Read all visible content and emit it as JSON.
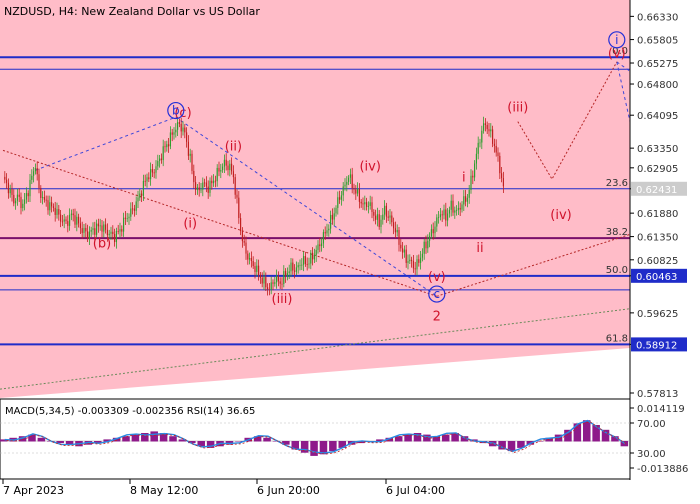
{
  "header": {
    "title": "NZDUSD, H4:  New Zealand Dollar vs US Dollar"
  },
  "colors": {
    "pink": "#ffbcc8",
    "candle_up": "#2e9e2e",
    "candle_down": "#c11f1f",
    "fib_blue": "#1f2cc9",
    "fib_purple": "#7a0f6a",
    "wave_label": "#d0122b",
    "wave_circle": "#2430d8",
    "trend_blue": "#3e47d9",
    "trend_red": "#b52626",
    "trend_green": "#6a8a5a",
    "macd_hist": "#8e1a8a",
    "rsi_line": "#2a8ae0",
    "price_red": "#e2202a",
    "price_gray": "#cccccc"
  },
  "chart_data": [
    {
      "type": "candlestick",
      "symbol": "NZDUSD",
      "timeframe": "H4",
      "ylim": [
        0.577,
        0.667
      ],
      "y_ticks": [
        "0.66330",
        "0.65805",
        "0.65275",
        "0.64800",
        "0.64095",
        "0.63350",
        "0.62905",
        "0.62431",
        "0.61880",
        "0.61350",
        "0.60825",
        "0.60463",
        "0.59625",
        "0.58912",
        "0.57813"
      ],
      "x_ticks": [
        "7 Apr 2023",
        "8 May 12:00",
        "6 Jun 20:00",
        "6 Jul 04:00"
      ],
      "price_path": [
        [
          0,
          0.627
        ],
        [
          3,
          0.6245
        ],
        [
          6,
          0.6215
        ],
        [
          8,
          0.6225
        ],
        [
          11,
          0.6205
        ],
        [
          14,
          0.624
        ],
        [
          16,
          0.627
        ],
        [
          18,
          0.6298
        ],
        [
          20,
          0.624
        ],
        [
          23,
          0.6215
        ],
        [
          26,
          0.6205
        ],
        [
          29,
          0.6195
        ],
        [
          32,
          0.6175
        ],
        [
          35,
          0.6165
        ],
        [
          38,
          0.6185
        ],
        [
          41,
          0.617
        ],
        [
          44,
          0.615
        ],
        [
          47,
          0.614
        ],
        [
          50,
          0.615
        ],
        [
          54,
          0.616
        ],
        [
          58,
          0.6145
        ],
        [
          62,
          0.6135
        ],
        [
          65,
          0.615
        ],
        [
          68,
          0.6175
        ],
        [
          71,
          0.619
        ],
        [
          74,
          0.621
        ],
        [
          77,
          0.624
        ],
        [
          80,
          0.627
        ],
        [
          83,
          0.628
        ],
        [
          86,
          0.63
        ],
        [
          89,
          0.633
        ],
        [
          92,
          0.635
        ],
        [
          95,
          0.6375
        ],
        [
          98,
          0.639
        ],
        [
          101,
          0.6368
        ],
        [
          104,
          0.631
        ],
        [
          106,
          0.626
        ],
        [
          108,
          0.6235
        ],
        [
          111,
          0.6255
        ],
        [
          114,
          0.6245
        ],
        [
          117,
          0.6262
        ],
        [
          120,
          0.6285
        ],
        [
          123,
          0.63
        ],
        [
          126,
          0.6292
        ],
        [
          128,
          0.627
        ],
        [
          130,
          0.621
        ],
        [
          132,
          0.615
        ],
        [
          134,
          0.611
        ],
        [
          136,
          0.609
        ],
        [
          138,
          0.6075
        ],
        [
          140,
          0.6065
        ],
        [
          142,
          0.605
        ],
        [
          145,
          0.603
        ],
        [
          148,
          0.6015
        ],
        [
          151,
          0.604
        ],
        [
          154,
          0.603
        ],
        [
          157,
          0.605
        ],
        [
          160,
          0.6065
        ],
        [
          163,
          0.606
        ],
        [
          166,
          0.608
        ],
        [
          169,
          0.6075
        ],
        [
          172,
          0.609
        ],
        [
          175,
          0.611
        ],
        [
          178,
          0.6135
        ],
        [
          181,
          0.616
        ],
        [
          184,
          0.619
        ],
        [
          187,
          0.6225
        ],
        [
          190,
          0.625
        ],
        [
          192,
          0.6275
        ],
        [
          194,
          0.625
        ],
        [
          197,
          0.623
        ],
        [
          200,
          0.6205
        ],
        [
          203,
          0.621
        ],
        [
          206,
          0.6185
        ],
        [
          209,
          0.6165
        ],
        [
          212,
          0.6195
        ],
        [
          215,
          0.6175
        ],
        [
          218,
          0.615
        ],
        [
          221,
          0.611
        ],
        [
          224,
          0.6085
        ],
        [
          227,
          0.6075
        ],
        [
          229,
          0.6065
        ],
        [
          231,
          0.608
        ],
        [
          234,
          0.611
        ],
        [
          237,
          0.6135
        ],
        [
          240,
          0.616
        ],
        [
          243,
          0.619
        ],
        [
          246,
          0.618
        ],
        [
          249,
          0.6205
        ],
        [
          252,
          0.619
        ],
        [
          255,
          0.621
        ],
        [
          258,
          0.6225
        ],
        [
          260,
          0.626
        ],
        [
          262,
          0.63
        ],
        [
          264,
          0.634
        ],
        [
          266,
          0.6375
        ],
        [
          268,
          0.639
        ],
        [
          270,
          0.6375
        ],
        [
          272,
          0.6355
        ],
        [
          274,
          0.6325
        ],
        [
          276,
          0.629
        ],
        [
          278,
          0.6243
        ]
      ]
    },
    {
      "type": "indicator",
      "macd_label": "MACD(5,34,5) -0.003309 -0.002356 RSI(14) 36.65",
      "y_ticks": [
        "0.014119",
        "70.00",
        "30.00",
        "-0.013886"
      ],
      "macd_hist": [
        0.001,
        0.002,
        0.003,
        0.004,
        0.002,
        0.0,
        -0.001,
        -0.002,
        -0.003,
        -0.002,
        -0.001,
        0.001,
        0.002,
        0.003,
        0.004,
        0.005,
        0.006,
        0.005,
        0.003,
        0.001,
        -0.001,
        -0.003,
        -0.004,
        -0.003,
        -0.002,
        0.0,
        0.002,
        0.003,
        0.002,
        0.0,
        -0.002,
        -0.005,
        -0.007,
        -0.009,
        -0.008,
        -0.006,
        -0.004,
        -0.002,
        -0.001,
        0.0,
        0.001,
        0.002,
        0.003,
        0.004,
        0.005,
        0.004,
        0.003,
        0.004,
        0.005,
        0.003,
        0.001,
        -0.001,
        -0.003,
        -0.005,
        -0.006,
        -0.004,
        -0.002,
        0.0,
        0.002,
        0.004,
        0.007,
        0.011,
        0.013,
        0.01,
        0.007,
        0.003,
        -0.003
      ]
    }
  ],
  "levels": [
    {
      "price": 0.65406,
      "fib": "0.0",
      "label": "0.65406",
      "color": "#1f2cc9",
      "thick": true,
      "box": true
    },
    {
      "price": 0.62431,
      "fib": "23.6",
      "label": "0.62431",
      "color": "#1f2cc9",
      "thick": false,
      "box": true,
      "box_bg": "#cccccc"
    },
    {
      "price": 0.61316,
      "fib": "38.2",
      "label": "0.61316",
      "color": "#7a0f6a",
      "thick": true,
      "box": true,
      "box_bg": "#e2202a"
    },
    {
      "price": 0.60463,
      "fib": "50.0",
      "label": "0.60463",
      "color": "#1f2cc9",
      "thick": true,
      "box": true
    },
    {
      "price": 0.58912,
      "fib": "61.8",
      "label": "0.58912",
      "color": "#1f2cc9",
      "thick": true,
      "box": true
    }
  ],
  "wave_labels": [
    {
      "text": "(c)",
      "bar": 100,
      "price": 0.6405,
      "style": "red"
    },
    {
      "text": "b",
      "bar": 96,
      "price": 0.642,
      "style": "circle"
    },
    {
      "text": "(b)",
      "bar": 55,
      "price": 0.611,
      "style": "red"
    },
    {
      "text": "(i)",
      "bar": 104,
      "price": 0.6155,
      "style": "red"
    },
    {
      "text": "(ii)",
      "bar": 128,
      "price": 0.633,
      "style": "red"
    },
    {
      "text": "(iii)",
      "bar": 155,
      "price": 0.5985,
      "style": "red"
    },
    {
      "text": "(iv)",
      "bar": 204,
      "price": 0.6285,
      "style": "red"
    },
    {
      "text": "(v)",
      "bar": 241,
      "price": 0.6035,
      "style": "red"
    },
    {
      "text": "c",
      "bar": 241,
      "price": 0.6005,
      "style": "circle"
    },
    {
      "text": "2",
      "bar": 241,
      "price": 0.5945,
      "style": "red"
    },
    {
      "text": "i",
      "bar": 256,
      "price": 0.626,
      "style": "red"
    },
    {
      "text": "ii",
      "bar": 265,
      "price": 0.61,
      "style": "red"
    },
    {
      "text": "(iii)",
      "bar": 286,
      "price": 0.6418,
      "style": "red"
    },
    {
      "text": "(iv)",
      "bar": 310,
      "price": 0.6175,
      "style": "red"
    },
    {
      "text": "(v)",
      "bar": 341,
      "price": 0.654,
      "style": "red"
    },
    {
      "text": "i",
      "bar": 341,
      "price": 0.658,
      "style": "circle"
    }
  ]
}
